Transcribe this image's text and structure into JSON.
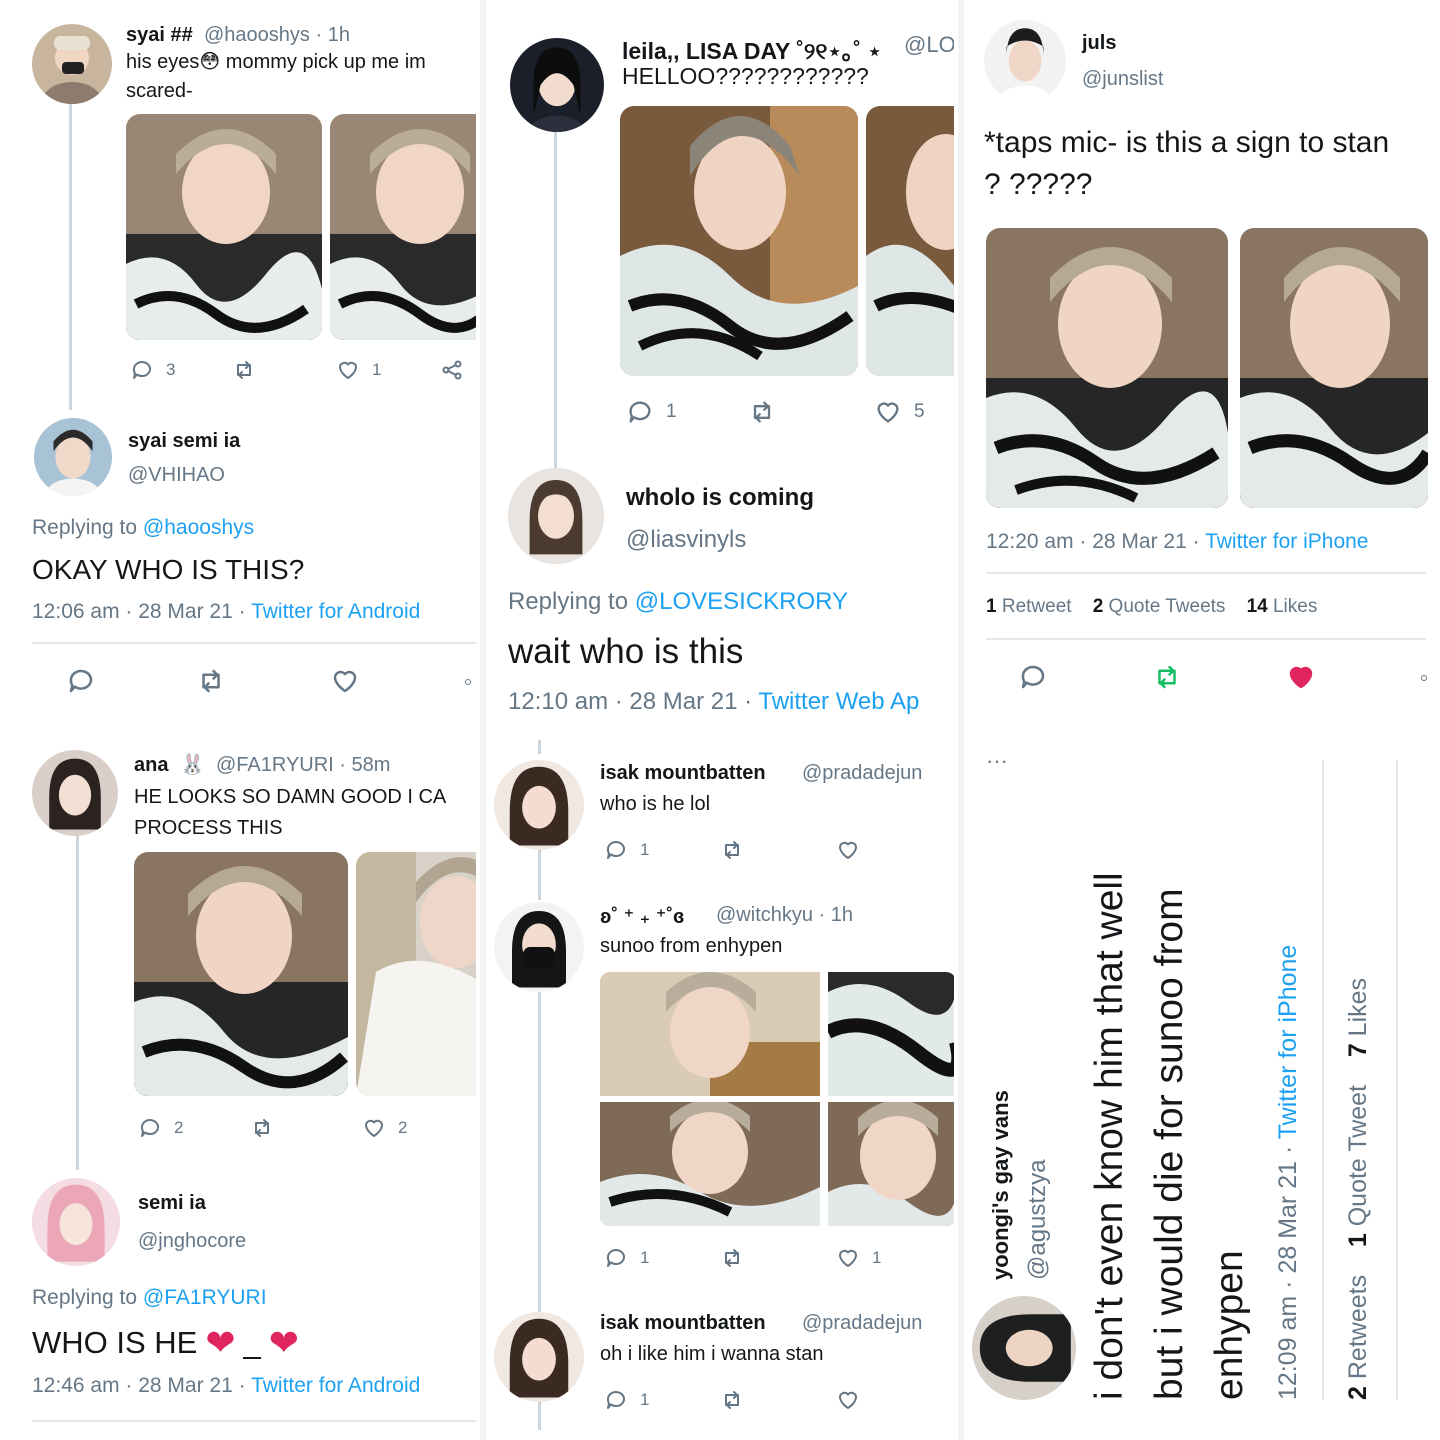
{
  "panel1": {
    "tweet": {
      "name": "syai ##",
      "handle": "@haooshys · 1h",
      "text_a": "his eyes",
      "emoji": "😳",
      "text_b": " mommy pick up me im scared-",
      "replies": "3",
      "likes": "1"
    },
    "reply": {
      "name": "syai semi ia",
      "handle": "@VHIHAO",
      "replying_to_label": "Replying to",
      "replying_to": "@haooshys",
      "text": "OKAY WHO IS THIS?",
      "time": "12:06 am · 28 Mar 21",
      "client": "Twitter for Android"
    }
  },
  "panel2": {
    "tweet": {
      "name": "leila,, LISA DAY ˚୨୧⋆｡˚ ⋆",
      "handle": "@LO",
      "text": "HELLOO????????????",
      "replies": "1",
      "likes": "5"
    },
    "reply": {
      "name": "wholo is coming",
      "handle": "@liasvinyls",
      "replying_to_label": "Replying to",
      "replying_to": "@LOVESICKRORY",
      "text": "wait who is this",
      "time": "12:10 am · 28 Mar 21",
      "client": "Twitter Web Ap"
    }
  },
  "panel3": {
    "name": "juls",
    "handle": "@junslist",
    "text": "*taps mic- is this a sign to stan ? ?????",
    "time": "12:20 am · 28 Mar 21",
    "client": "Twitter for iPhone",
    "stats": [
      {
        "n": "1",
        "l": "Retweet"
      },
      {
        "n": "2",
        "l": "Quote Tweets"
      },
      {
        "n": "14",
        "l": "Likes"
      }
    ]
  },
  "panel4": {
    "tweet": {
      "name": "ana",
      "handle": "@FA1RYURI · 58m",
      "text": "HE LOOKS SO DAMN GOOD I CA PROCESS THIS",
      "replies": "2",
      "likes": "2"
    },
    "reply": {
      "name": "semi ia",
      "handle": "@jnghocore",
      "replying_to_label": "Replying to",
      "replying_to": "@FA1RYURI",
      "text": "WHO IS HE",
      "heart_sep": "_",
      "time": "12:46 am · 28 Mar 21",
      "client": "Twitter for Android"
    }
  },
  "panel5": {
    "t1": {
      "name": "isak mountbatten",
      "handle": "@pradadejun",
      "text": "who is he lol",
      "replies": "1"
    },
    "t2": {
      "name": "ʚ˚ ⁺ ₊ ⁺˚ɞ",
      "handle": "@witchkyu · 1h",
      "text": "sunoo from enhypen",
      "replies": "1",
      "likes": "1"
    },
    "t3": {
      "name": "isak mountbatten",
      "handle": "@pradadejun",
      "text": "oh i like him i wanna stan",
      "replies": "1"
    }
  },
  "panel6": {
    "dots": "···",
    "name": "yoongi's gay vans",
    "handle": "@agustzya",
    "line1": "i don't even know him that well",
    "line2": "but i would die for sunoo from",
    "line3": "enhypen",
    "time": "12:09 am · 28 Mar 21 · ",
    "client": "Twitter for iPhone",
    "s1n": "2",
    "s1l": "Retweets",
    "s2n": "1",
    "s2l": "Quote Tweet",
    "s3n": "7",
    "s3l": "Likes"
  },
  "colors": {
    "link": "#1da1f2",
    "like": "#e0245e",
    "retweet": "#17bf63",
    "muted": "#657786"
  }
}
